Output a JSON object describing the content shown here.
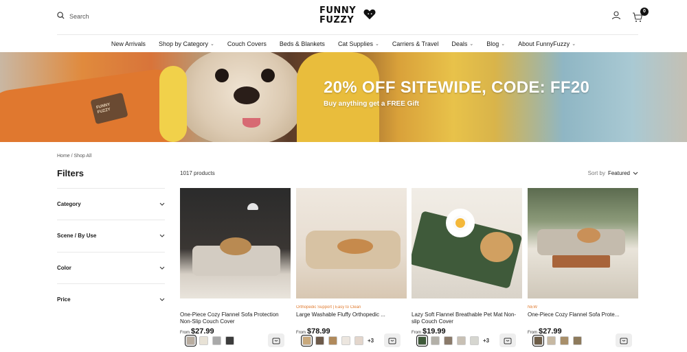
{
  "header": {
    "search_label": "Search",
    "logo_line1": "FUNNY",
    "logo_line2": "FUZZY",
    "cart_count": "0"
  },
  "nav": [
    {
      "label": "New Arrivals",
      "dropdown": false
    },
    {
      "label": "Shop by Category",
      "dropdown": true
    },
    {
      "label": "Couch Covers",
      "dropdown": false
    },
    {
      "label": "Beds & Blankets",
      "dropdown": false
    },
    {
      "label": "Cat Supplies",
      "dropdown": true
    },
    {
      "label": "Carriers & Travel",
      "dropdown": false
    },
    {
      "label": "Deals",
      "dropdown": true
    },
    {
      "label": "Blog",
      "dropdown": true
    },
    {
      "label": "About FunnyFuzzy",
      "dropdown": true
    }
  ],
  "banner": {
    "title": "20% OFF SITEWIDE, CODE: FF20",
    "subtitle": "Buy anything get a FREE Gift",
    "tag_text": "FUNNY FUZZY"
  },
  "breadcrumb": "Home / Shop All",
  "filters": {
    "title": "Filters",
    "groups": [
      "Category",
      "Scene / By Use",
      "Color",
      "Price"
    ]
  },
  "listing": {
    "count": "1017 products",
    "sort_label": "Sort by",
    "sort_value": "Featured"
  },
  "products": [
    {
      "badge": "",
      "name": "One-Piece Cozy Flannel Sofa Protection Non-Slip Couch Cover",
      "price_prefix": "From",
      "price": "$27.99",
      "more": "",
      "swatches": [
        "#b9ada0",
        "#e8e2d6",
        "#a9a9a9",
        "#3c3c3c"
      ],
      "scene": "dark"
    },
    {
      "badge": "Orthopedic Support | Easy to Clean",
      "name": "Large Washable Fluffy Orthopedic ...",
      "price_prefix": "From",
      "price": "$78.99",
      "more": "+3",
      "swatches": [
        "#c9a97c",
        "#6d5a4a",
        "#b08a5c",
        "#ece6df",
        "#e3d6cc"
      ],
      "scene": "warm"
    },
    {
      "badge": "",
      "name": "Lazy Soft Flannel Breathable Pet Mat Non-slip Couch Cover",
      "price_prefix": "From",
      "price": "$19.99",
      "more": "+3",
      "swatches": [
        "#3f5a3a",
        "#b3b0a8",
        "#8a7a6a",
        "#c8c0b4",
        "#d6d6d0"
      ],
      "scene": "green"
    },
    {
      "badge": "NEW",
      "name": "One-Piece Cozy Flannel Sofa Prote...",
      "price_prefix": "From",
      "price": "$27.99",
      "more": "",
      "swatches": [
        "#6d5d48",
        "#c7b9a3",
        "#a88f6a",
        "#8d7a5c"
      ],
      "scene": "garden"
    }
  ]
}
